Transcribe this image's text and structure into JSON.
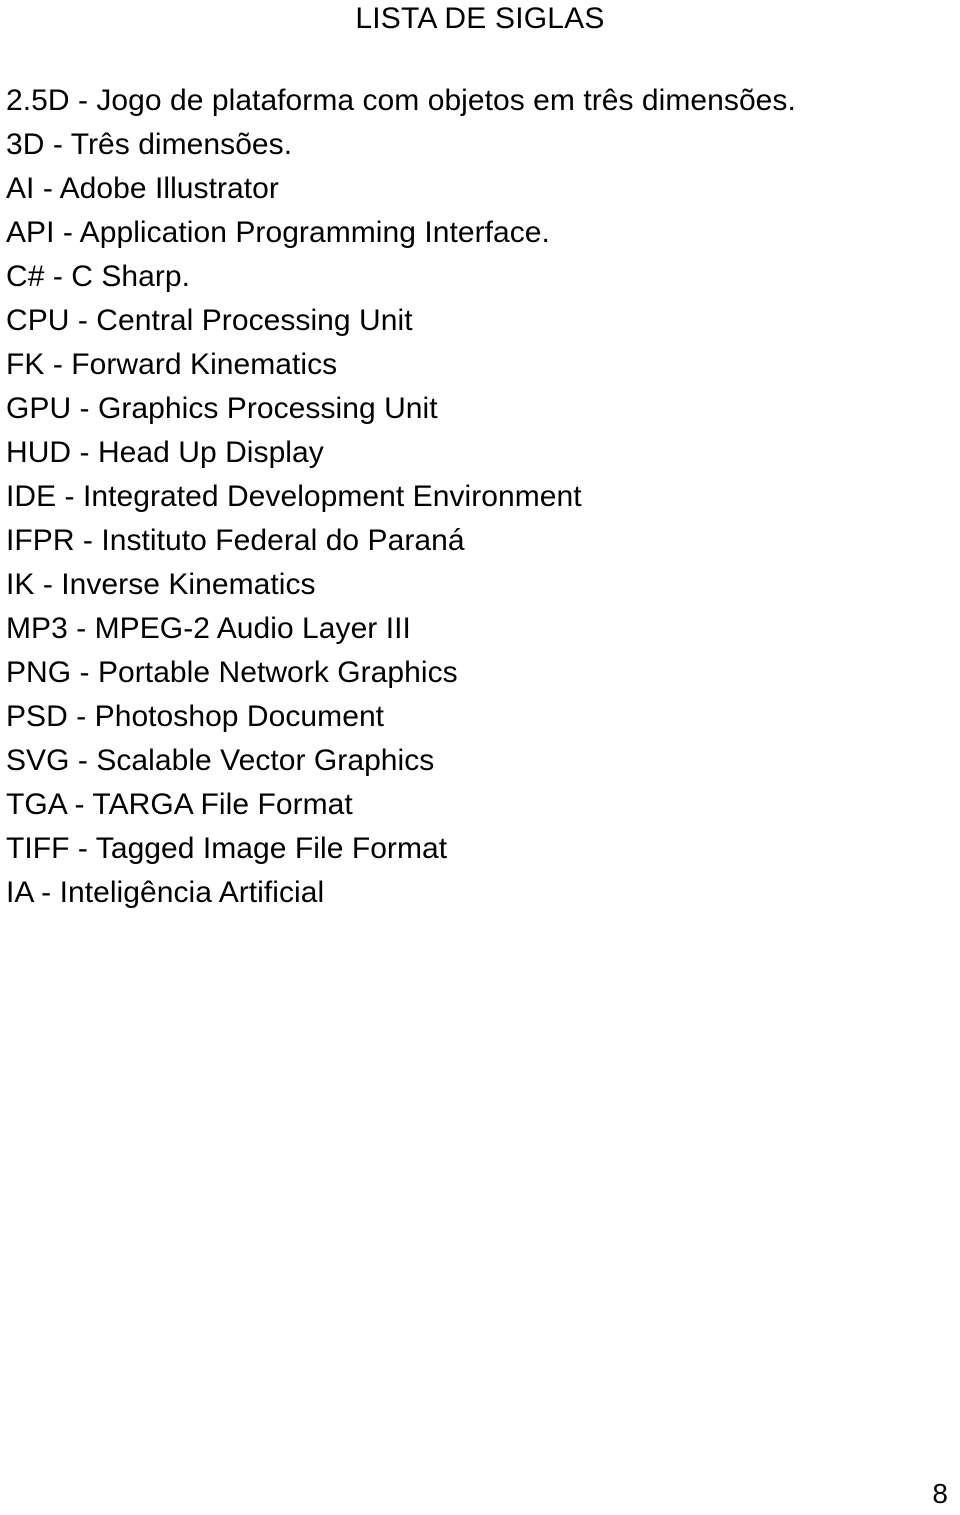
{
  "document": {
    "title": "LISTA DE SIGLAS",
    "page_number": "8",
    "text_color": "#000000",
    "background_color": "#ffffff"
  },
  "acronyms": [
    {
      "entry": "2.5D - Jogo de plataforma com objetos em três dimensões."
    },
    {
      "entry": "3D - Três dimensões."
    },
    {
      "entry": "AI - Adobe Illustrator"
    },
    {
      "entry": "API - Application Programming Interface."
    },
    {
      "entry": "C# - C Sharp."
    },
    {
      "entry": "CPU - Central Processing Unit"
    },
    {
      "entry": "FK - Forward Kinematics"
    },
    {
      "entry": "GPU - Graphics Processing Unit"
    },
    {
      "entry": "HUD - Head Up Display"
    },
    {
      "entry": "IDE - Integrated Development Environment"
    },
    {
      "entry": "IFPR - Instituto Federal do Paraná"
    },
    {
      "entry": "IK - Inverse Kinematics"
    },
    {
      "entry": "MP3 - MPEG-2 Audio Layer III"
    },
    {
      "entry": "PNG - Portable Network Graphics"
    },
    {
      "entry": "PSD - Photoshop Document"
    },
    {
      "entry": "SVG - Scalable Vector Graphics"
    },
    {
      "entry": "TGA - TARGA File Format"
    },
    {
      "entry": "TIFF - Tagged Image File Format"
    },
    {
      "entry": "IA - Inteligência Artificial"
    }
  ]
}
